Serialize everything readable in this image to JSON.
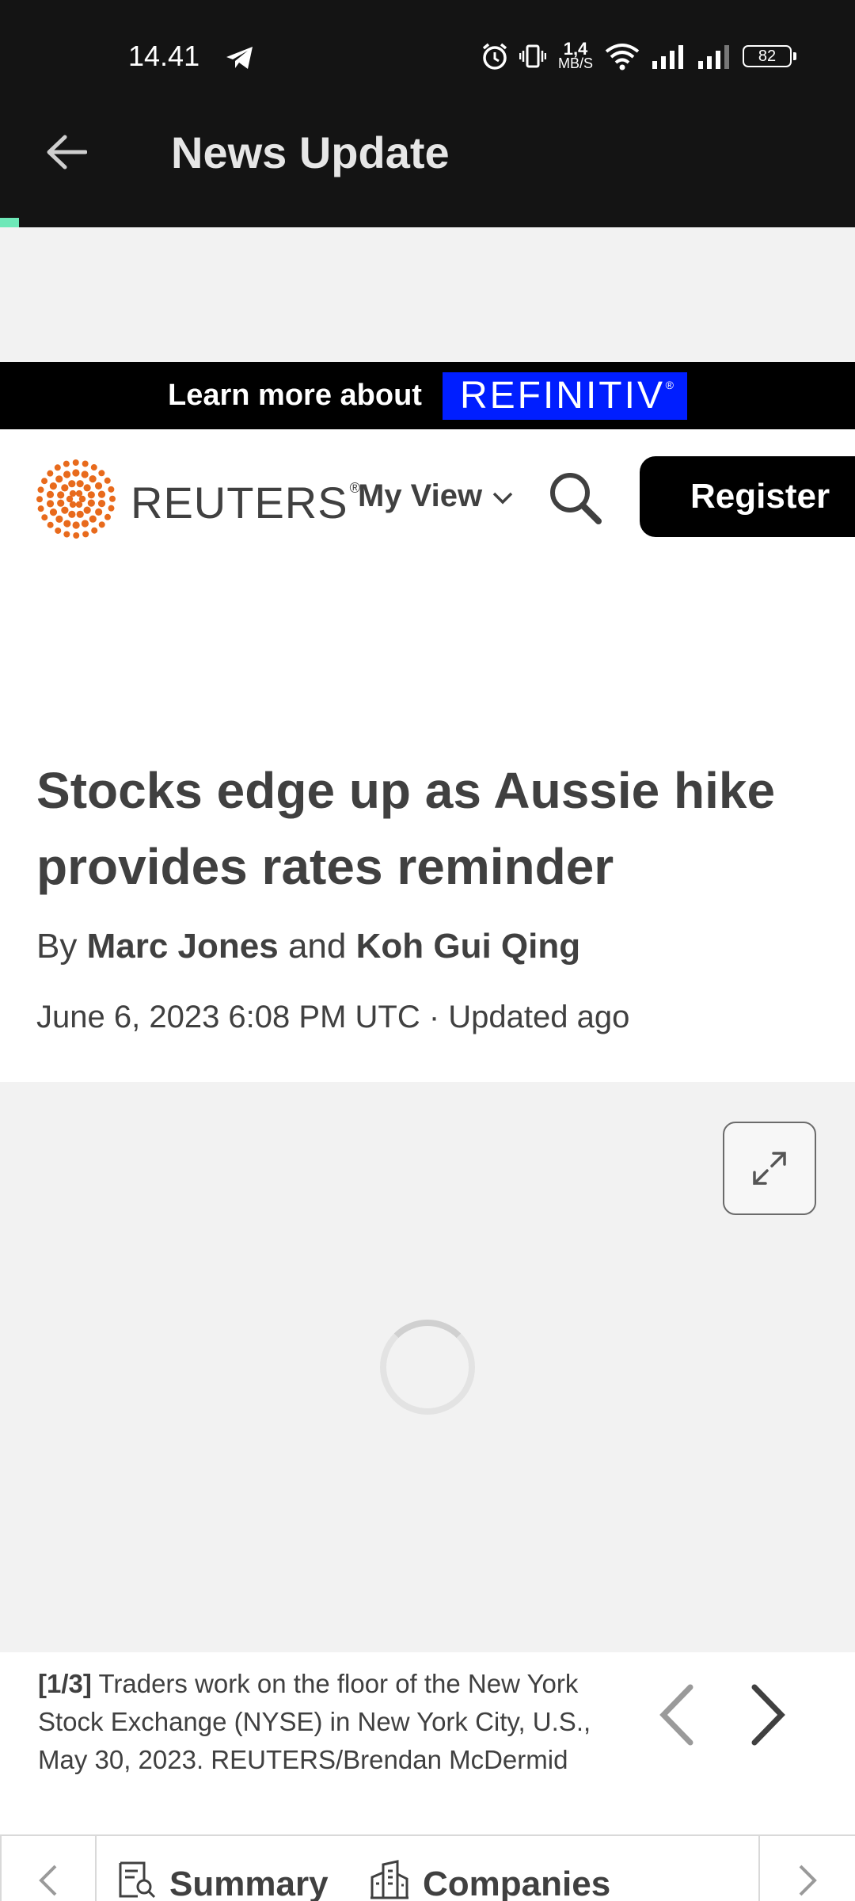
{
  "status_bar": {
    "time": "14.41",
    "net_speed_value": "1,4",
    "net_speed_unit": "MB/S",
    "battery": "82"
  },
  "app_bar": {
    "title": "News Update"
  },
  "ad": {
    "text": "Learn more about",
    "brand": "REFINITIV",
    "brand_mark": "®"
  },
  "header": {
    "logo_text": "REUTERS",
    "logo_mark": "®",
    "my_view": "My View",
    "register": "Register"
  },
  "article": {
    "headline": "Stocks edge up as Aussie hike provides rates reminder",
    "by": "By",
    "author_1": "Marc Jones",
    "and": "and",
    "author_2": "Koh Gui Qing",
    "date": "June 6, 2023 6:08 PM UTC · Updated ago"
  },
  "gallery": {
    "counter": "[1/3]",
    "caption": "Traders work on the floor of the New York Stock Exchange (NYSE) in New York City, U.S., May 30, 2023. REUTERS/Brendan McDermid"
  },
  "tabs": {
    "summary": "Summary",
    "companies": "Companies"
  },
  "colors": {
    "app_bar": "#141414",
    "ad_brand": "#001eff",
    "reuters_orange": "#e86a1c",
    "accent": "#6ee8b8"
  }
}
